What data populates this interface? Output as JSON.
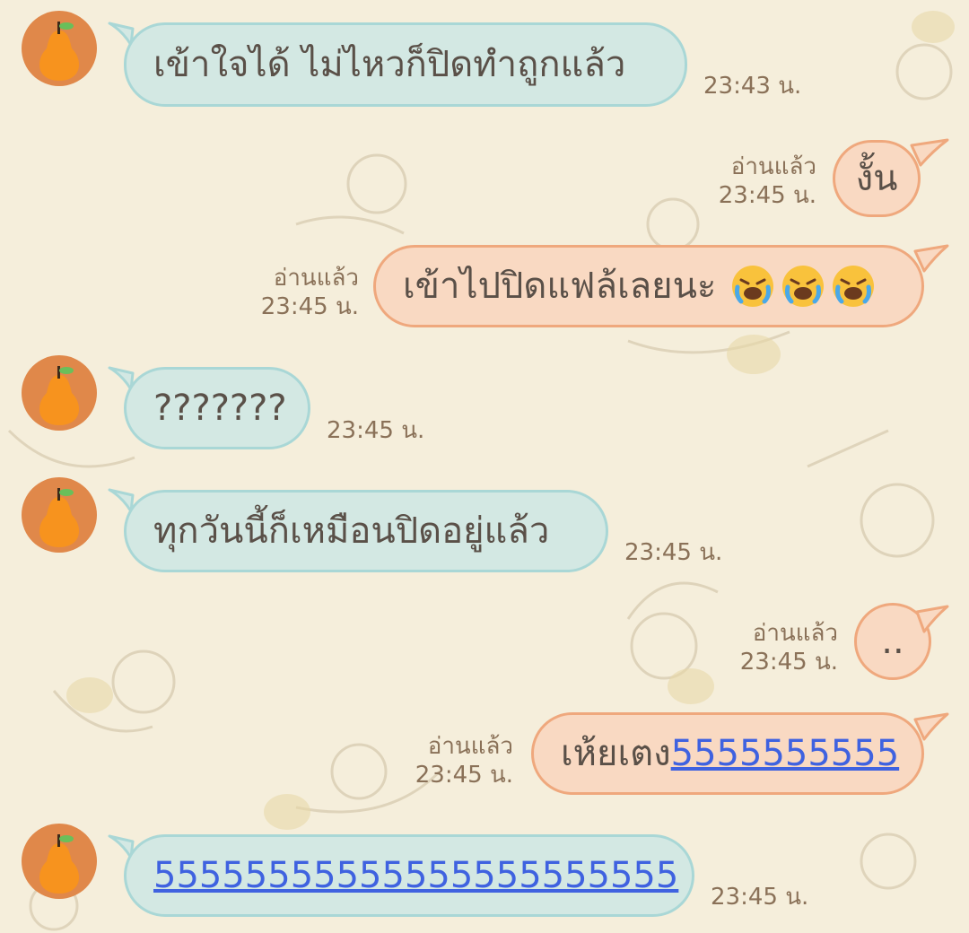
{
  "colors": {
    "background": "#f5eedb",
    "incoming_bubble": "#d3e8e3",
    "incoming_border": "#a9d7d6",
    "outgoing_bubble": "#f9d9c2",
    "outgoing_border": "#efa87d",
    "link": "#3f62e0",
    "timestamp": "#8a7158"
  },
  "contact": {
    "avatar_icon": "orange-fruit-icon"
  },
  "messages": [
    {
      "dir": "in",
      "text": "เข้าใจได้ ไม่ไหวก็ปิดทำถูกแล้ว",
      "time": "23:43 น."
    },
    {
      "dir": "out",
      "text": "งั้น",
      "read": "อ่านแล้ว",
      "time": "23:45 น."
    },
    {
      "dir": "out",
      "text": "เข้าไปปิดแฟล้เลยนะ",
      "emoji": "loudly-crying-face-icon",
      "read": "อ่านแล้ว",
      "time": "23:45 น."
    },
    {
      "dir": "in",
      "text": "???????",
      "time": "23:45 น."
    },
    {
      "dir": "in",
      "text": "ทุกวันนี้ก็เหมือนปิดอยู่แล้ว",
      "time": "23:45 น."
    },
    {
      "dir": "out",
      "text": "..",
      "read": "อ่านแล้ว",
      "time": "23:45 น."
    },
    {
      "dir": "out",
      "text": "เห้ยเตง",
      "link": "5555555555",
      "read": "อ่านแล้ว",
      "time": "23:45 น."
    },
    {
      "dir": "in",
      "link": "55555555555555555555555",
      "time": "23:45 น."
    }
  ]
}
